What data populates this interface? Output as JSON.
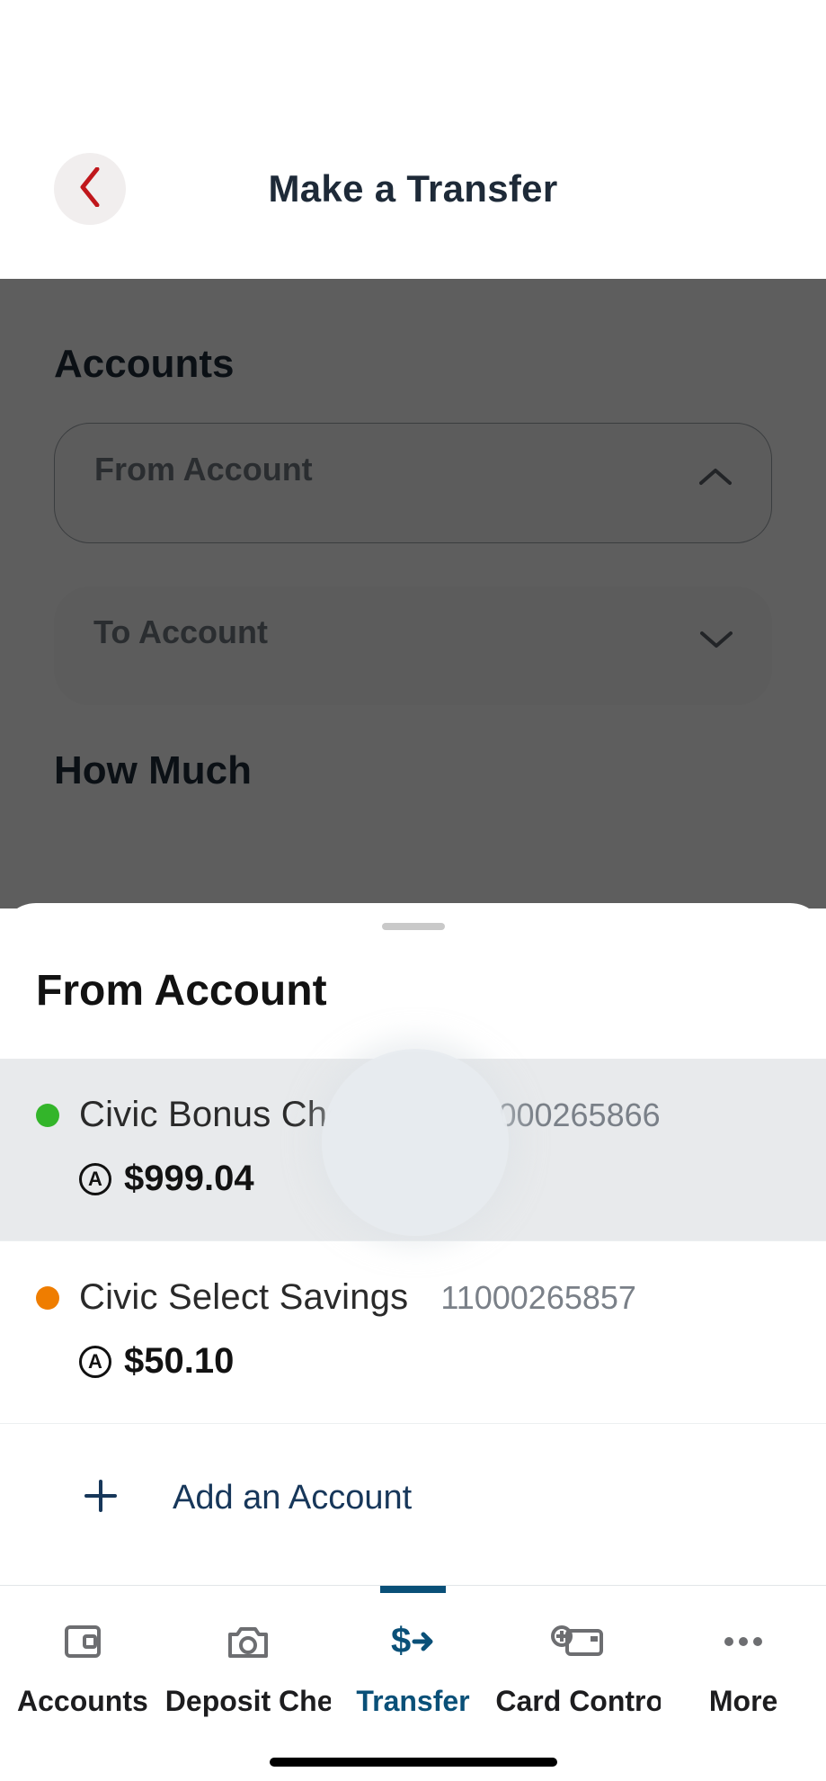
{
  "header": {
    "title": "Make a Transfer"
  },
  "page": {
    "accounts_heading": "Accounts",
    "from_label": "From Account",
    "to_label": "To Account",
    "how_much_heading": "How Much"
  },
  "sheet": {
    "title": "From Account",
    "accounts": [
      {
        "name": "Civic Bonus Checking",
        "number_pale": "11",
        "number_rest": "000265866",
        "balance": "$999.04",
        "dot": "#33b52a",
        "selected": true
      },
      {
        "name": "Civic Select Savings",
        "number_pale": "",
        "number_rest": "11000265857",
        "balance": "$50.10",
        "dot": "#ef7d00",
        "selected": false
      }
    ],
    "add_label": "Add an Account"
  },
  "tabs": {
    "items": [
      {
        "label": "Accounts"
      },
      {
        "label": "Deposit Check"
      },
      {
        "label": "Transfer"
      },
      {
        "label": "Card Controls"
      },
      {
        "label": "More"
      }
    ],
    "active_index": 2
  },
  "colors": {
    "nav_active": "#0a5078",
    "back_accent": "#c0171c"
  }
}
